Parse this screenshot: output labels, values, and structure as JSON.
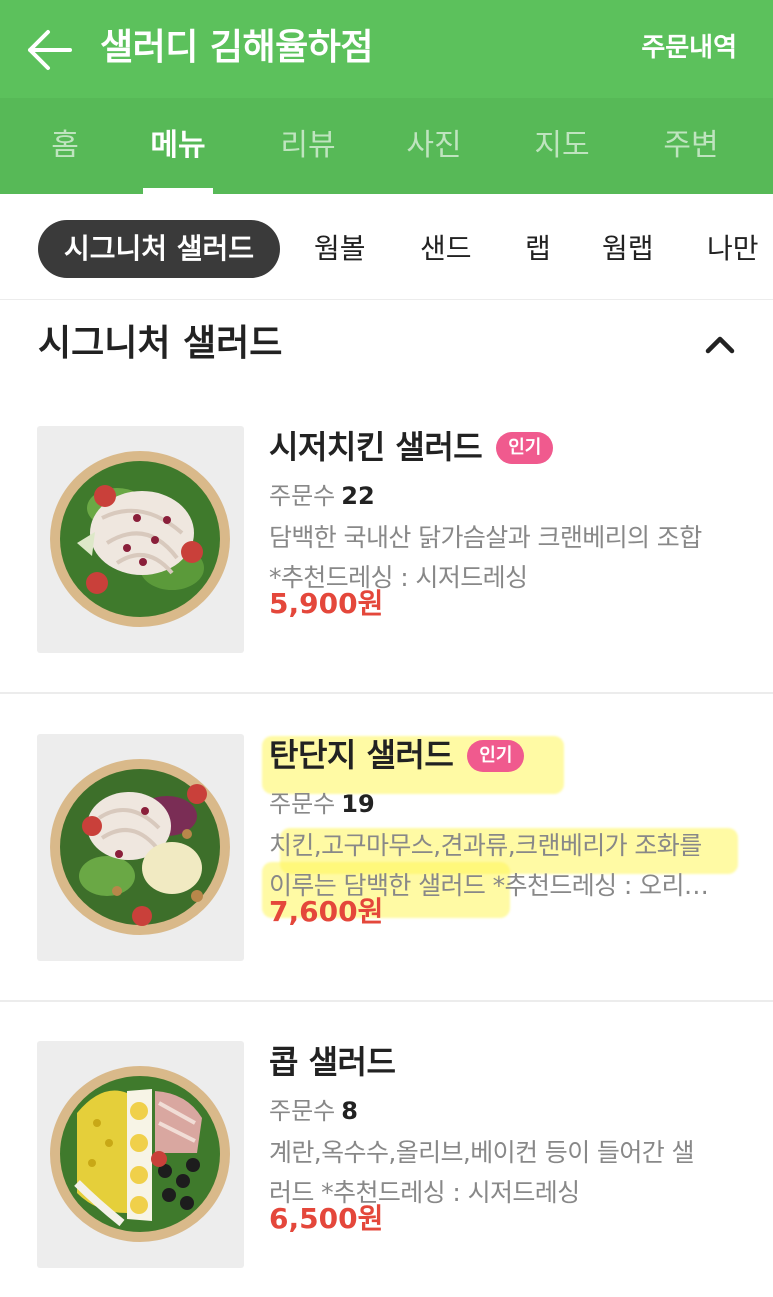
{
  "header": {
    "title": "샐러디 김해율하점",
    "orders_link": "주문내역"
  },
  "tabs": [
    {
      "label": "홈",
      "active": false
    },
    {
      "label": "메뉴",
      "active": true
    },
    {
      "label": "리뷰",
      "active": false
    },
    {
      "label": "사진",
      "active": false
    },
    {
      "label": "지도",
      "active": false
    },
    {
      "label": "주변",
      "active": false
    }
  ],
  "categories": [
    {
      "label": "시그니처 샐러드",
      "active": true
    },
    {
      "label": "웜볼",
      "active": false
    },
    {
      "label": "샌드",
      "active": false
    },
    {
      "label": "랩",
      "active": false
    },
    {
      "label": "웜랩",
      "active": false
    },
    {
      "label": "나만",
      "active": false
    }
  ],
  "section": {
    "title": "시그니처 샐러드",
    "expanded": true
  },
  "menu_items": [
    {
      "name": "시저치킨 샐러드",
      "badge": "인기",
      "order_label": "주문수",
      "order_count": "22",
      "desc_line1": "담백한 국내산 닭가슴살과 크랜베리의 조합",
      "desc_line2": "*추천드레싱 : 시저드레싱",
      "price": "5,900원",
      "highlighted": false
    },
    {
      "name": "탄단지 샐러드",
      "badge": "인기",
      "order_label": "주문수",
      "order_count": "19",
      "desc_line1": "치킨,고구마무스,견과류,크랜베리가 조화를",
      "desc_line2": "이루는 담백한 샐러드 *추천드레싱 : 오리…",
      "price": "7,600원",
      "highlighted": true
    },
    {
      "name": "콥 샐러드",
      "badge": "",
      "order_label": "주문수",
      "order_count": "8",
      "desc_line1": "계란,옥수수,올리브,베이컨 등이 들어간 샐",
      "desc_line2": "러드 *추천드레싱 : 시저드레싱",
      "price": "6,500원",
      "highlighted": false
    }
  ],
  "colors": {
    "header_green": "#5cc15c",
    "tab_bar_green": "#57b957",
    "price_red": "#e4473b",
    "badge_pink": "#f05a8e",
    "active_chip": "#3a3a3a",
    "highlighter_yellow": "#fff55a"
  },
  "icons": {
    "back": "back-arrow-icon",
    "collapse": "chevron-up-icon"
  }
}
